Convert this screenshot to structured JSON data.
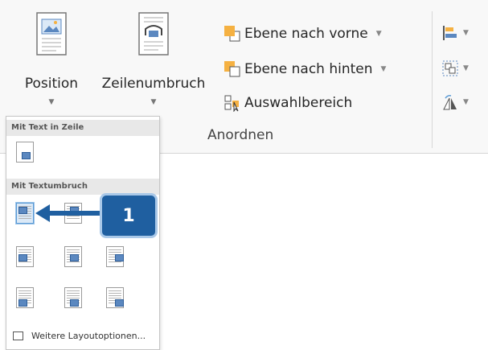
{
  "ribbon": {
    "position_label": "Position",
    "wrap_label": "Zeilenumbruch",
    "forward_label": "Ebene nach vorne",
    "backward_label": "Ebene nach hinten",
    "selection_label": "Auswahlbereich",
    "group_label": "Anordnen"
  },
  "dropdown": {
    "section_inline": "Mit Text in Zeile",
    "section_wrap": "Mit Textumbruch",
    "more_options": "Weitere Layoutoptionen..."
  },
  "callout": {
    "number": "1"
  },
  "colors": {
    "accent": "#1f5fa0",
    "icon_orange": "#f5b142",
    "icon_blue": "#5b88c0"
  },
  "icons": [
    "position-icon",
    "wrap-text-icon",
    "bring-forward-icon",
    "send-backward-icon",
    "selection-pane-icon",
    "align-icon",
    "group-icon",
    "rotate-icon",
    "layout-options-icon"
  ]
}
